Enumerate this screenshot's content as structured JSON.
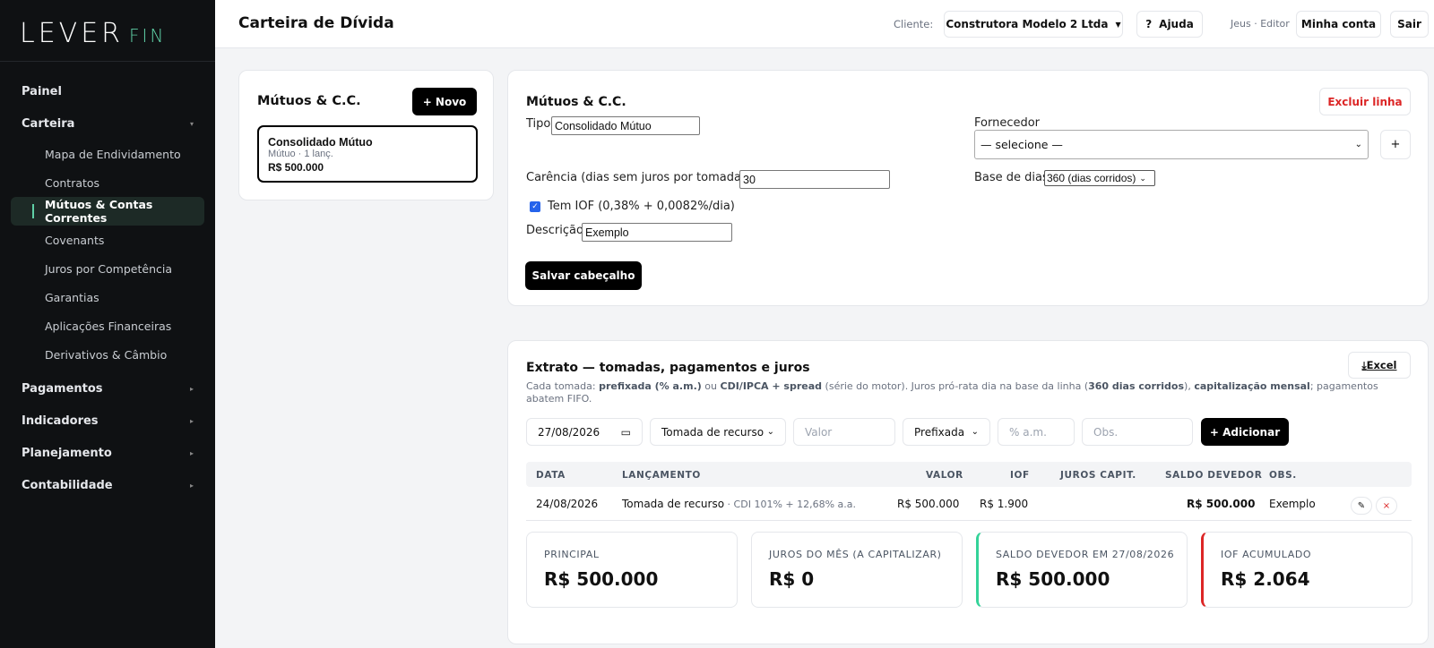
{
  "brand": {
    "part1": "LEVER",
    "part2": "FIN"
  },
  "sidebar": {
    "items": [
      {
        "label": "Painel"
      },
      {
        "label": "Carteira",
        "caret": "▾"
      },
      {
        "label": "Pagamentos",
        "caret": "▸"
      },
      {
        "label": "Indicadores",
        "caret": "▸"
      },
      {
        "label": "Planejamento",
        "caret": "▸"
      },
      {
        "label": "Contabilidade",
        "caret": "▸"
      }
    ],
    "subitems": [
      {
        "label": "Mapa de Endividamento"
      },
      {
        "label": "Contratos"
      },
      {
        "label": "Mútuos & Contas Correntes"
      },
      {
        "label": "Covenants"
      },
      {
        "label": "Juros por Competência"
      },
      {
        "label": "Garantias"
      },
      {
        "label": "Aplicações Financeiras"
      },
      {
        "label": "Derivativos & Câmbio"
      }
    ]
  },
  "topbar": {
    "title": "Carteira de Dívida",
    "client_label": "Cliente:",
    "client_value": "Construtora Modelo 2 Ltda",
    "help_icon": "?",
    "help_label": "Ajuda",
    "user_label": "Jeus · Editor",
    "account_label": "Minha conta",
    "logout_label": "Sair"
  },
  "list": {
    "title": "Mútuos & C.C.",
    "new_label": "+ Novo",
    "entries": [
      {
        "name": "Consolidado Mútuo",
        "sub": "Mútuo · 1 lanç.",
        "value": "R$ 500.000"
      }
    ]
  },
  "form": {
    "title": "Mútuos & C.C.",
    "delete_label": "Excluir linha",
    "tipo_label": "Tipo",
    "tipo_value": "Consolidado Mútuo",
    "fornecedor_label": "Fornecedor",
    "fornecedor_value": "— selecione —",
    "plus_label": "+",
    "carencia_label": "Carência (dias sem juros por tomada)",
    "carencia_value": "30",
    "base_label": "Base de dias",
    "base_value": "360 (dias corridos)",
    "iof_label": "Tem IOF (0,38% + 0,0082%/dia)",
    "iof_checked": true,
    "descricao_label": "Descrição",
    "descricao_value": "Exemplo",
    "save_label": "Salvar cabeçalho"
  },
  "statement": {
    "title": "Extrato — tomadas, pagamentos e juros",
    "excel_label": "Excel",
    "desc": {
      "p1": "Cada tomada: ",
      "b1": "prefixada (% a.m.)",
      "p2": " ou ",
      "b2": "CDI/IPCA + spread",
      "p3": " (série do motor). Juros pró-rata dia na base da linha (",
      "b3": "360 dias corridos",
      "p4": "), ",
      "b4": "capitalização mensal",
      "p5": "; pagamentos abatem FIFO."
    },
    "controls": {
      "date": "27/08/2026",
      "type": "Tomada de recurso",
      "value_placeholder": "Valor",
      "rate_type": "Prefixada",
      "rate_placeholder": "% a.m.",
      "obs_placeholder": "Obs.",
      "add_label": "+ Adicionar"
    },
    "columns": [
      "DATA",
      "LANÇAMENTO",
      "VALOR",
      "IOF",
      "JUROS CAPIT.",
      "SALDO DEVEDOR",
      "OBS."
    ],
    "rows": [
      {
        "data": "24/08/2026",
        "lancamento": "Tomada de recurso",
        "detalhe": " · CDI 101% + 12,68% a.a.",
        "valor": "R$ 500.000",
        "iof": "R$ 1.900",
        "juros": "",
        "saldo": "R$ 500.000",
        "obs": "Exemplo"
      }
    ],
    "kpis": [
      {
        "label": "PRINCIPAL",
        "value": "R$ 500.000"
      },
      {
        "label": "JUROS DO MÊS (A CAPITALIZAR)",
        "value": "R$ 0"
      },
      {
        "label": "SALDO DEVEDOR EM 27/08/2026",
        "value": "R$ 500.000"
      },
      {
        "label": "IOF ACUMULADO",
        "value": "R$ 2.064"
      }
    ]
  },
  "colors": {
    "accent": "#5fd0a6",
    "danger": "#dc2626",
    "sidebar_bg": "#0f1113",
    "kpi_green": "#34d399"
  }
}
